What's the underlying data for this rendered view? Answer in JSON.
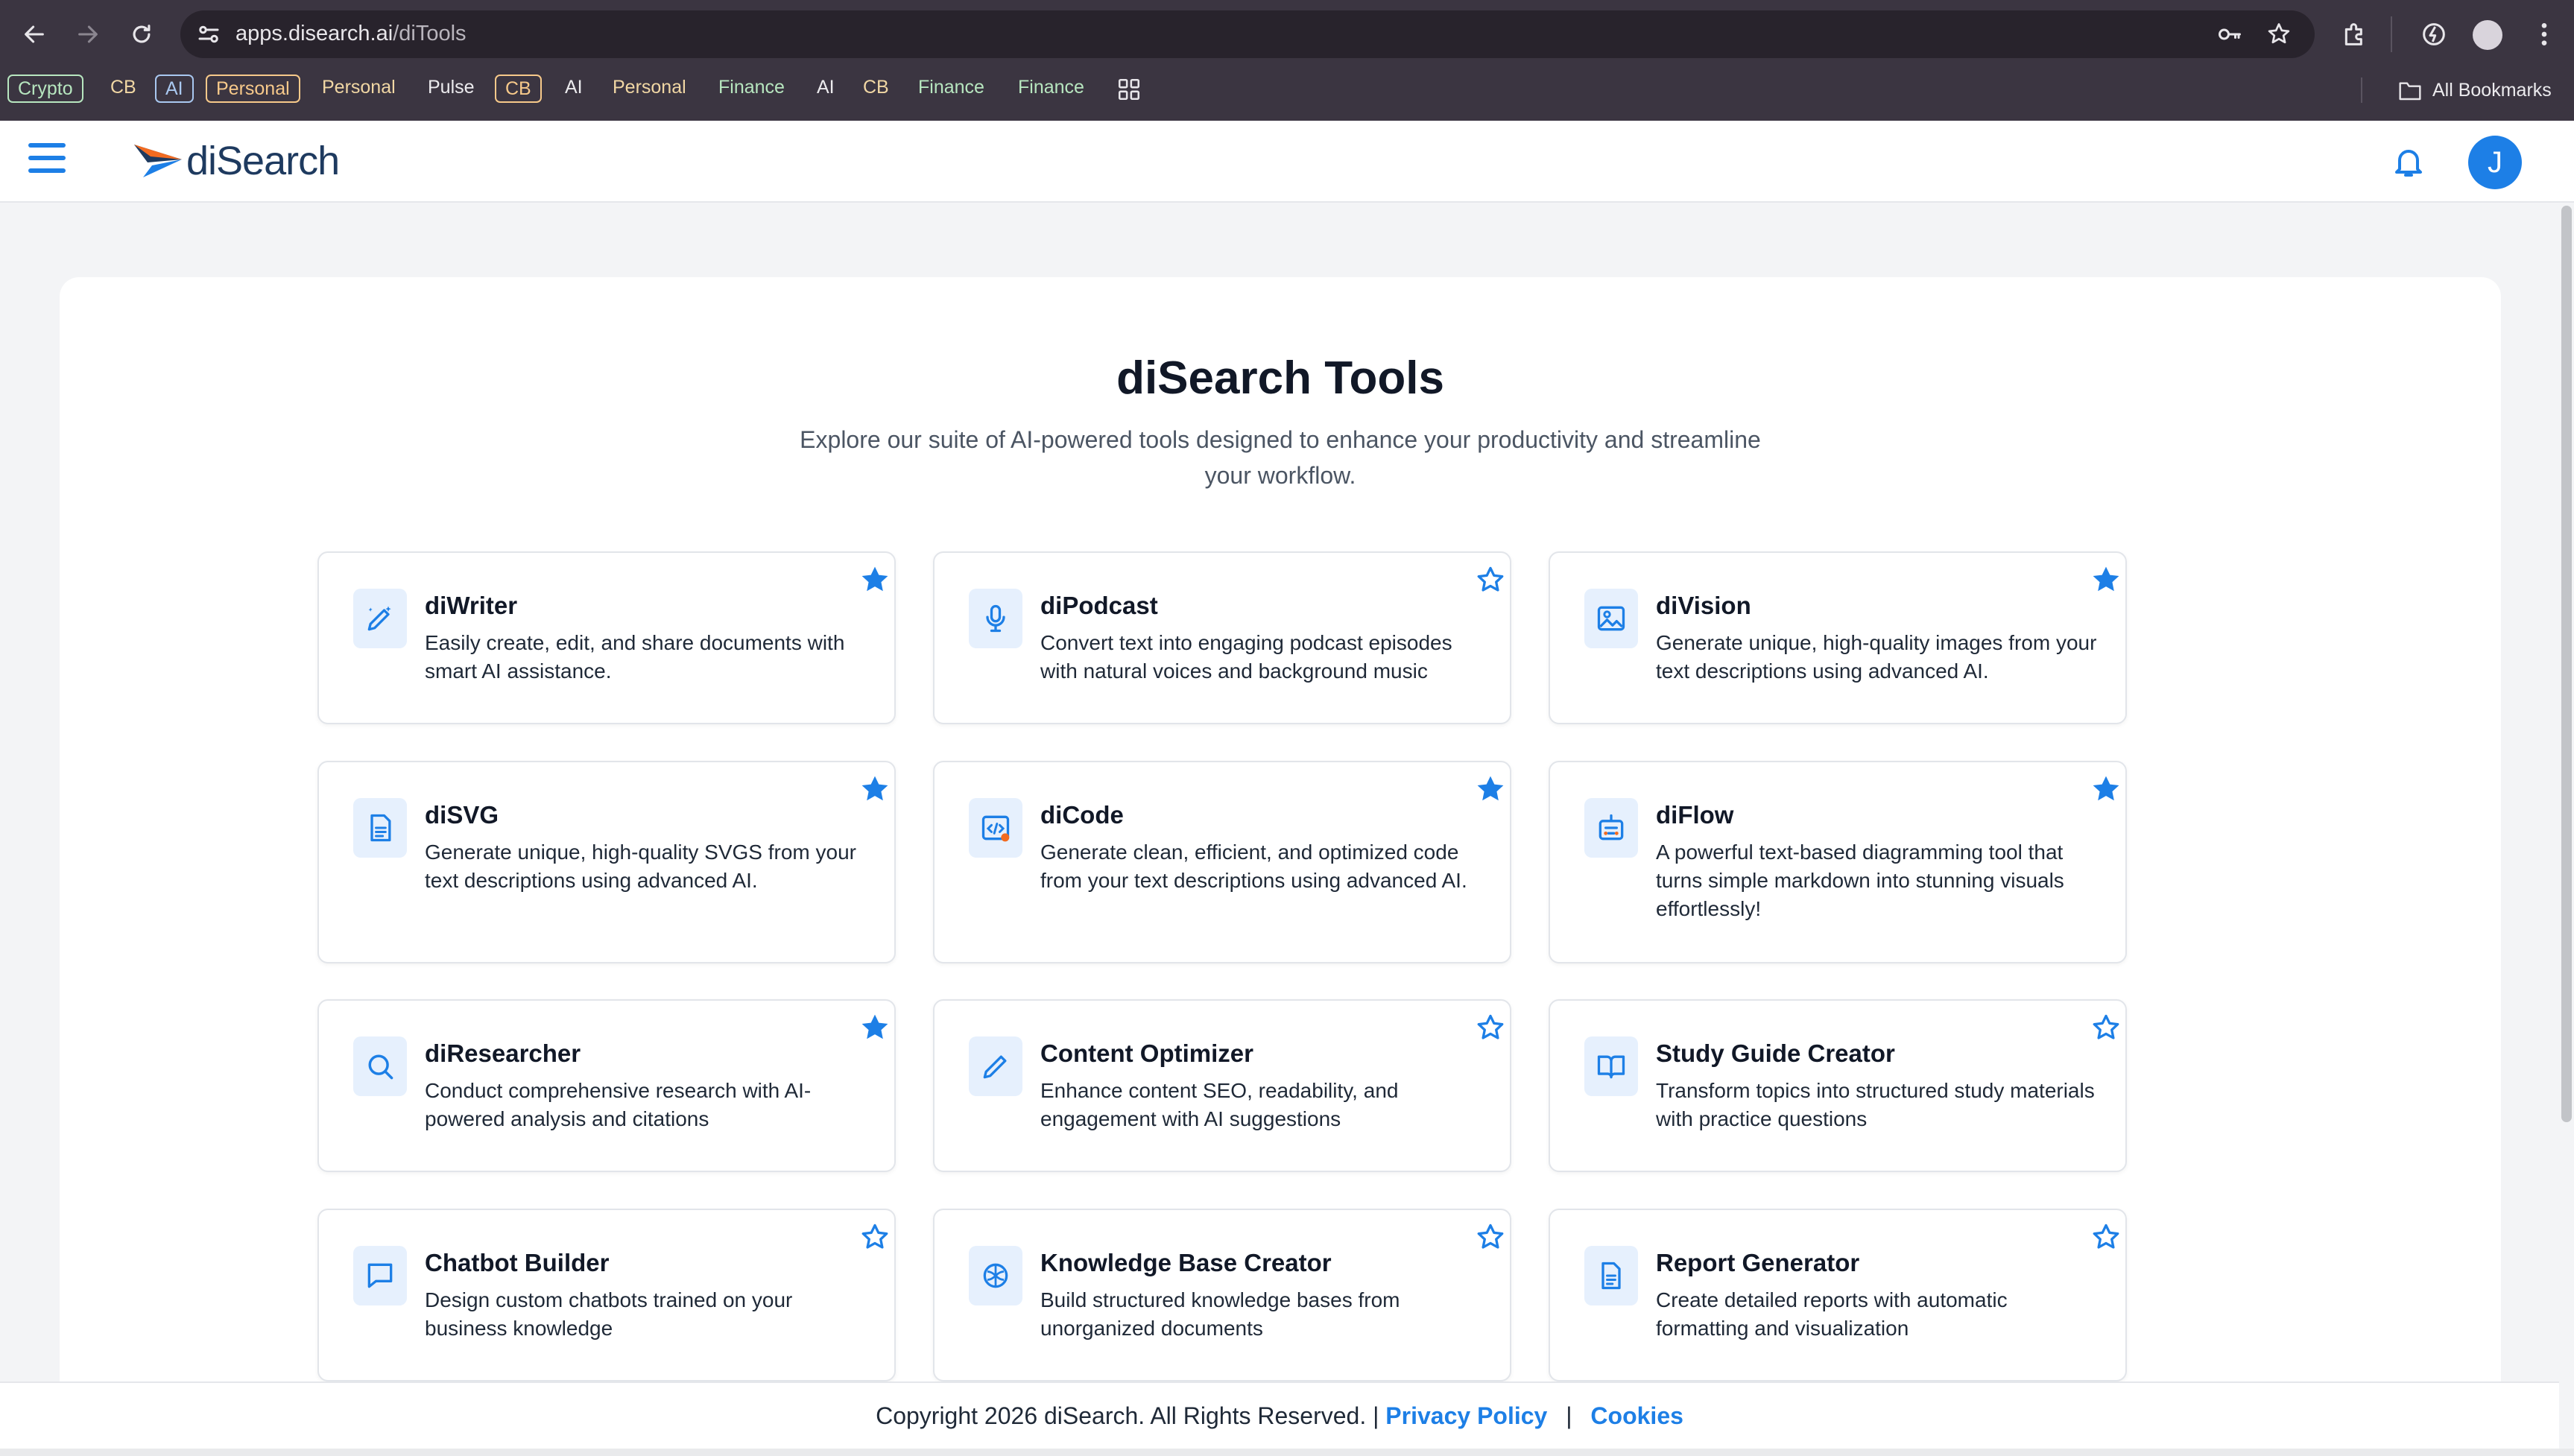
{
  "browser": {
    "url_host": "apps.disearch.ai",
    "url_path": "/diTools",
    "bookmarks": [
      {
        "label": "Crypto",
        "style": "outlined green"
      },
      {
        "label": "CB",
        "style": "tan"
      },
      {
        "label": "AI",
        "style": "outlined blue"
      },
      {
        "label": "Personal",
        "style": "outlined orange"
      },
      {
        "label": "Personal",
        "style": "tan"
      },
      {
        "label": "Pulse",
        "style": "plain"
      },
      {
        "label": "CB",
        "style": "outlined orange"
      },
      {
        "label": "AI",
        "style": "plain"
      },
      {
        "label": "Personal",
        "style": "tan"
      },
      {
        "label": "Finance",
        "style": "green"
      },
      {
        "label": "AI",
        "style": "plain"
      },
      {
        "label": "CB",
        "style": "tan"
      },
      {
        "label": "Finance",
        "style": "green"
      },
      {
        "label": "Finance",
        "style": "green"
      }
    ],
    "all_bookmarks_label": "All Bookmarks"
  },
  "header": {
    "logo_text": "diSearch",
    "avatar_initial": "J"
  },
  "main": {
    "title": "diSearch Tools",
    "subtitle": "Explore our suite of AI-powered tools designed to enhance your productivity and streamline your workflow.",
    "tools": [
      {
        "name": "diWriter",
        "desc": "Easily create, edit, and share documents with smart AI assistance.",
        "favorited": true,
        "icon": "pen-sparkle-icon"
      },
      {
        "name": "diPodcast",
        "desc": "Convert text into engaging podcast episodes with natural voices and background music",
        "favorited": false,
        "icon": "microphone-icon"
      },
      {
        "name": "diVision",
        "desc": "Generate unique, high-quality images from your text descriptions using advanced AI.",
        "favorited": true,
        "icon": "image-icon"
      },
      {
        "name": "diSVG",
        "desc": "Generate unique, high-quality SVGS from your text descriptions using advanced AI.",
        "favorited": true,
        "icon": "svg-file-icon"
      },
      {
        "name": "diCode",
        "desc": "Generate clean, efficient, and optimized code from your text descriptions using advanced AI.",
        "favorited": true,
        "icon": "code-window-icon"
      },
      {
        "name": "diFlow",
        "desc": "A powerful text-based diagramming tool that turns simple markdown into stunning visuals effortlessly!",
        "favorited": true,
        "icon": "flow-diagram-icon"
      },
      {
        "name": "diResearcher",
        "desc": "Conduct comprehensive research with AI-powered analysis and citations",
        "favorited": true,
        "icon": "search-icon"
      },
      {
        "name": "Content Optimizer",
        "desc": "Enhance content SEO, readability, and engagement with AI suggestions",
        "favorited": false,
        "icon": "pencil-icon"
      },
      {
        "name": "Study Guide Creator",
        "desc": "Transform topics into structured study materials with practice questions",
        "favorited": false,
        "icon": "book-icon"
      },
      {
        "name": "Chatbot Builder",
        "desc": "Design custom chatbots trained on your business knowledge",
        "favorited": false,
        "icon": "chat-bubble-icon"
      },
      {
        "name": "Knowledge Base Creator",
        "desc": "Build structured knowledge bases from unorganized documents",
        "favorited": false,
        "icon": "brain-icon"
      },
      {
        "name": "Report Generator",
        "desc": "Create detailed reports with automatic formatting and visualization",
        "favorited": false,
        "icon": "document-icon"
      }
    ]
  },
  "footer": {
    "copyright": "Copyright 2026 diSearch. All Rights Reserved. |",
    "privacy": "Privacy Policy",
    "divider": "|",
    "cookies": "Cookies"
  },
  "colors": {
    "accent": "#1d7fe6",
    "chrome_bg": "#3b3541",
    "icon_tile": "#e6f0fd"
  }
}
